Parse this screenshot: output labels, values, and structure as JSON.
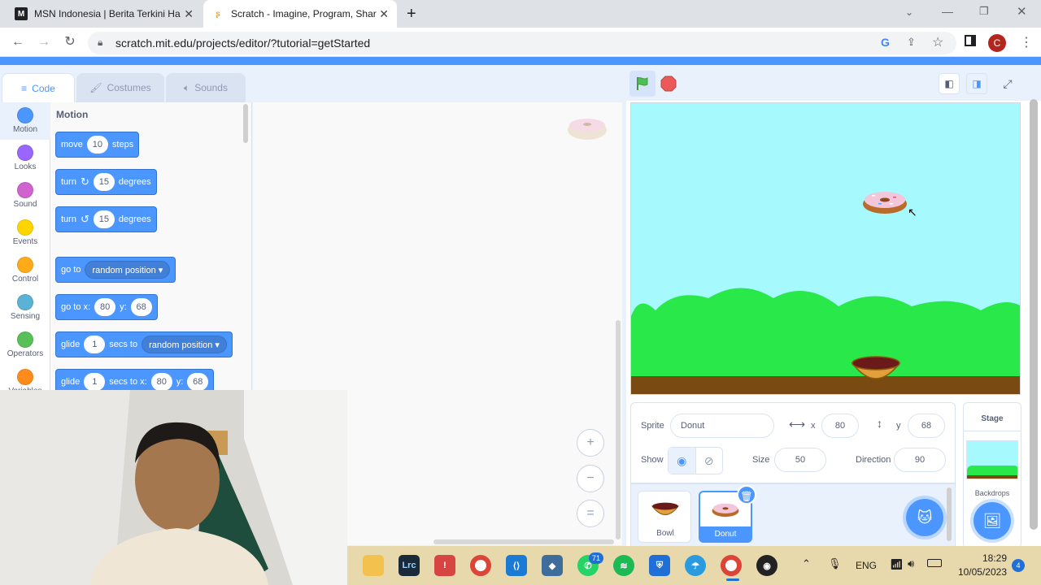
{
  "browser": {
    "tabs": [
      {
        "title": "MSN Indonesia | Berita Terkini Ha",
        "active": false
      },
      {
        "title": "Scratch - Imagine, Program, Shar",
        "active": true
      }
    ],
    "url": "scratch.mit.edu/projects/editor/?tutorial=getStarted",
    "profile_initial": "C"
  },
  "editor": {
    "tabs": [
      "Code",
      "Costumes",
      "Sounds"
    ],
    "categories": [
      {
        "label": "Motion",
        "color": "#4c97ff"
      },
      {
        "label": "Looks",
        "color": "#9966ff"
      },
      {
        "label": "Sound",
        "color": "#cf63cf"
      },
      {
        "label": "Events",
        "color": "#ffd500"
      },
      {
        "label": "Control",
        "color": "#ffab19"
      },
      {
        "label": "Sensing",
        "color": "#5cb1d6"
      },
      {
        "label": "Operators",
        "color": "#59c059"
      },
      {
        "label": "Variables",
        "color": "#ff8c1a"
      }
    ],
    "palette_heading": "Motion",
    "blocks": {
      "move": {
        "t1": "move",
        "v": "10",
        "t2": "steps"
      },
      "turn_right": {
        "t1": "turn",
        "v": "15",
        "t2": "degrees"
      },
      "turn_left": {
        "t1": "turn",
        "v": "15",
        "t2": "degrees"
      },
      "goto": {
        "t1": "go to",
        "drop": "random position ▾"
      },
      "goto_xy": {
        "t1": "go to x:",
        "x": "80",
        "t2": "y:",
        "y": "68"
      },
      "glide": {
        "t1": "glide",
        "v": "1",
        "t2": "secs to",
        "drop": "random position ▾"
      },
      "glide_xy": {
        "t1": "glide",
        "v": "1",
        "t2": "secs to x:",
        "x": "80",
        "t3": "y:",
        "y": "68"
      }
    },
    "zoom": {
      "in": "+",
      "out": "−",
      "reset": "="
    }
  },
  "sprite": {
    "label_sprite": "Sprite",
    "name": "Donut",
    "label_x": "x",
    "x": "80",
    "label_y": "y",
    "y": "68",
    "label_show": "Show",
    "label_size": "Size",
    "size": "50",
    "label_direction": "Direction",
    "direction": "90"
  },
  "sprites": [
    {
      "name": "Bowl",
      "selected": false
    },
    {
      "name": "Donut",
      "selected": true
    }
  ],
  "stage_panel": {
    "title": "Stage",
    "backdrops": "Backdrops"
  },
  "taskbar": {
    "lang": "ENG",
    "time": "18:29",
    "date": "10/05/2023",
    "notifications": "4",
    "whatsapp_badge": "71",
    "apps": [
      {
        "name": "file-explorer-icon",
        "color": "#f2c14e",
        "glyph": ""
      },
      {
        "name": "lightroom-icon",
        "color": "#1b2a3a",
        "glyph": "Lrc"
      },
      {
        "name": "app-icon",
        "color": "#d64541",
        "glyph": "!"
      },
      {
        "name": "chrome-icon",
        "color": "#db4437",
        "glyph": "●"
      },
      {
        "name": "vscode-icon",
        "color": "#1a7ad4",
        "glyph": "⟨⟩"
      },
      {
        "name": "virtualbox-icon",
        "color": "#3e6d9c",
        "glyph": "◆"
      },
      {
        "name": "whatsapp-icon",
        "color": "#25d366",
        "glyph": "✆"
      },
      {
        "name": "spotify-icon",
        "color": "#1db954",
        "glyph": "≋"
      },
      {
        "name": "defender-icon",
        "color": "#1f6fd6",
        "glyph": "⛨"
      },
      {
        "name": "weather-icon",
        "color": "#2b9be0",
        "glyph": "☂"
      },
      {
        "name": "chrome-profile-icon",
        "color": "#db4437",
        "glyph": "●"
      },
      {
        "name": "obs-icon",
        "color": "#222",
        "glyph": "◉"
      }
    ]
  }
}
